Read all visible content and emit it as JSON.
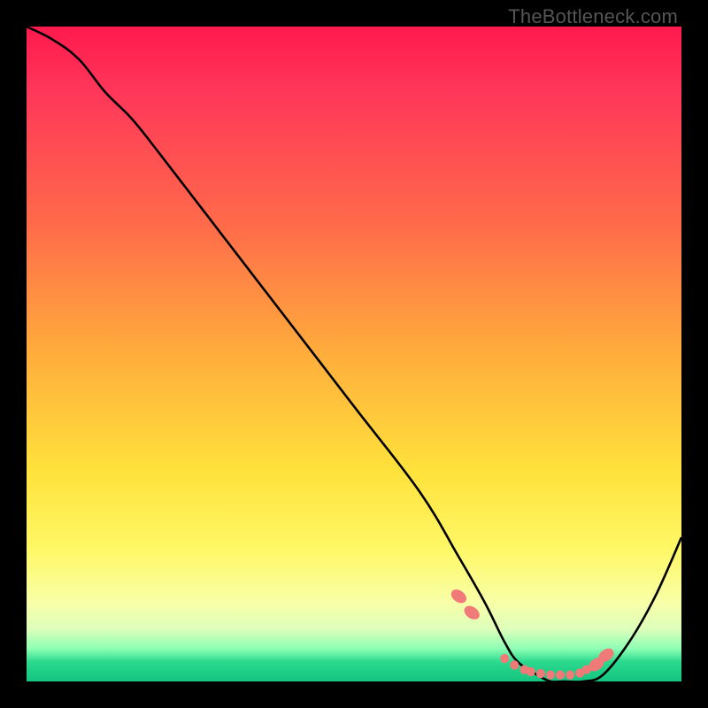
{
  "watermark": "TheBottleneck.com",
  "chart_data": {
    "type": "line",
    "title": "",
    "xlabel": "",
    "ylabel": "",
    "xlim": [
      0,
      100
    ],
    "ylim": [
      0,
      100
    ],
    "grid": false,
    "legend": false,
    "series": [
      {
        "name": "bottleneck-curve",
        "x": [
          0,
          4,
          8,
          12,
          16,
          20,
          30,
          40,
          50,
          60,
          66,
          70,
          73,
          75,
          78,
          80,
          82,
          85,
          88,
          92,
          96,
          100
        ],
        "y": [
          100,
          98,
          95,
          90,
          86,
          81,
          68,
          55,
          42,
          29,
          19,
          12,
          6,
          3,
          1,
          0,
          0,
          0,
          1,
          6,
          13,
          22
        ]
      }
    ],
    "markers": {
      "name": "pink-dots",
      "x": [
        66,
        68,
        73,
        74.5,
        76,
        77,
        78.5,
        80,
        81.5,
        83,
        84.5,
        85.5,
        87,
        88.5
      ],
      "y": [
        13,
        10.5,
        3.5,
        2.5,
        1.8,
        1.5,
        1.2,
        1,
        1,
        1,
        1.3,
        1.8,
        2.6,
        4
      ]
    }
  },
  "colors": {
    "curve": "#000000",
    "marker": "#f07a78",
    "background_top": "#ff1a4d",
    "background_bottom": "#15c47f",
    "frame": "#000000",
    "watermark": "#555555"
  }
}
